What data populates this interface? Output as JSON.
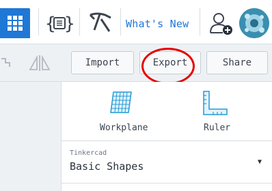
{
  "topbar": {
    "whats_new": "What's New",
    "icons": [
      "grid-icon",
      "codeblocks-icon",
      "simlab-icon",
      "add-user-icon",
      "avatar"
    ]
  },
  "toolbar": {
    "import_label": "Import",
    "export_label": "Export",
    "share_label": "Share",
    "icons": [
      "group-icon",
      "mirror-icon"
    ]
  },
  "panel": {
    "tools": [
      {
        "label": "Workplane",
        "icon": "workplane-icon"
      },
      {
        "label": "Ruler",
        "icon": "ruler-icon"
      }
    ],
    "library": {
      "source": "Tinkercad",
      "selected": "Basic Shapes"
    }
  },
  "colors": {
    "accent": "#1f77d6",
    "highlight_ring": "#e60000",
    "panel_bg": "#eef1f4"
  }
}
